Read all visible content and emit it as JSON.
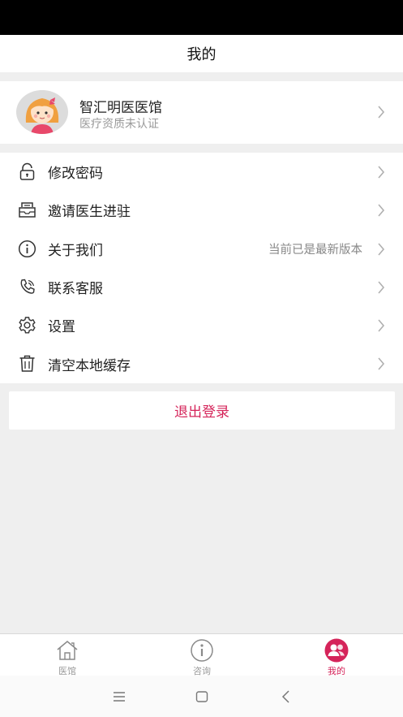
{
  "header": {
    "title": "我的"
  },
  "profile": {
    "name": "智汇明医医馆",
    "subtitle": "医疗资质未认证",
    "avatar_icon": "girl-avatar"
  },
  "menu": [
    {
      "label": "修改密码",
      "icon": "lock-icon",
      "value": ""
    },
    {
      "label": "邀请医生进驻",
      "icon": "envelope-icon",
      "value": ""
    },
    {
      "label": "关于我们",
      "icon": "info-icon",
      "value": "当前已是最新版本"
    },
    {
      "label": "联系客服",
      "icon": "phone-icon",
      "value": ""
    },
    {
      "label": "设置",
      "icon": "gear-icon",
      "value": ""
    },
    {
      "label": "清空本地缓存",
      "icon": "trash-icon",
      "value": ""
    }
  ],
  "logout": {
    "label": "退出登录"
  },
  "tabs": [
    {
      "label": "医馆",
      "icon": "home-icon",
      "active": false
    },
    {
      "label": "咨询",
      "icon": "info-circle-icon",
      "active": false
    },
    {
      "label": "我的",
      "icon": "user-group-icon",
      "active": true
    }
  ],
  "colors": {
    "accent": "#d5245a",
    "background": "#efefef",
    "muted": "#9a9a9a"
  }
}
